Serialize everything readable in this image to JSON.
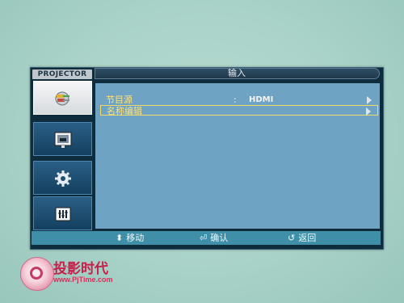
{
  "osd": {
    "brand": "PROJECTOR",
    "title": "输入",
    "sidebar": [
      {
        "icon": "input-plug-icon",
        "active": true
      },
      {
        "icon": "picture-icon",
        "active": false
      },
      {
        "icon": "gear-icon",
        "active": false
      },
      {
        "icon": "setup-sliders-icon",
        "active": false
      }
    ],
    "menu_items": [
      {
        "label": "节目源",
        "colon": ":",
        "value": "HDMI",
        "selected": false
      },
      {
        "label": "名称编辑",
        "colon": "",
        "value": "",
        "selected": true
      }
    ],
    "footer": {
      "move": "移动",
      "confirm": "确认",
      "back": "返回"
    }
  },
  "watermark": {
    "title": "投影时代",
    "url": "www.PjTime.com"
  }
}
